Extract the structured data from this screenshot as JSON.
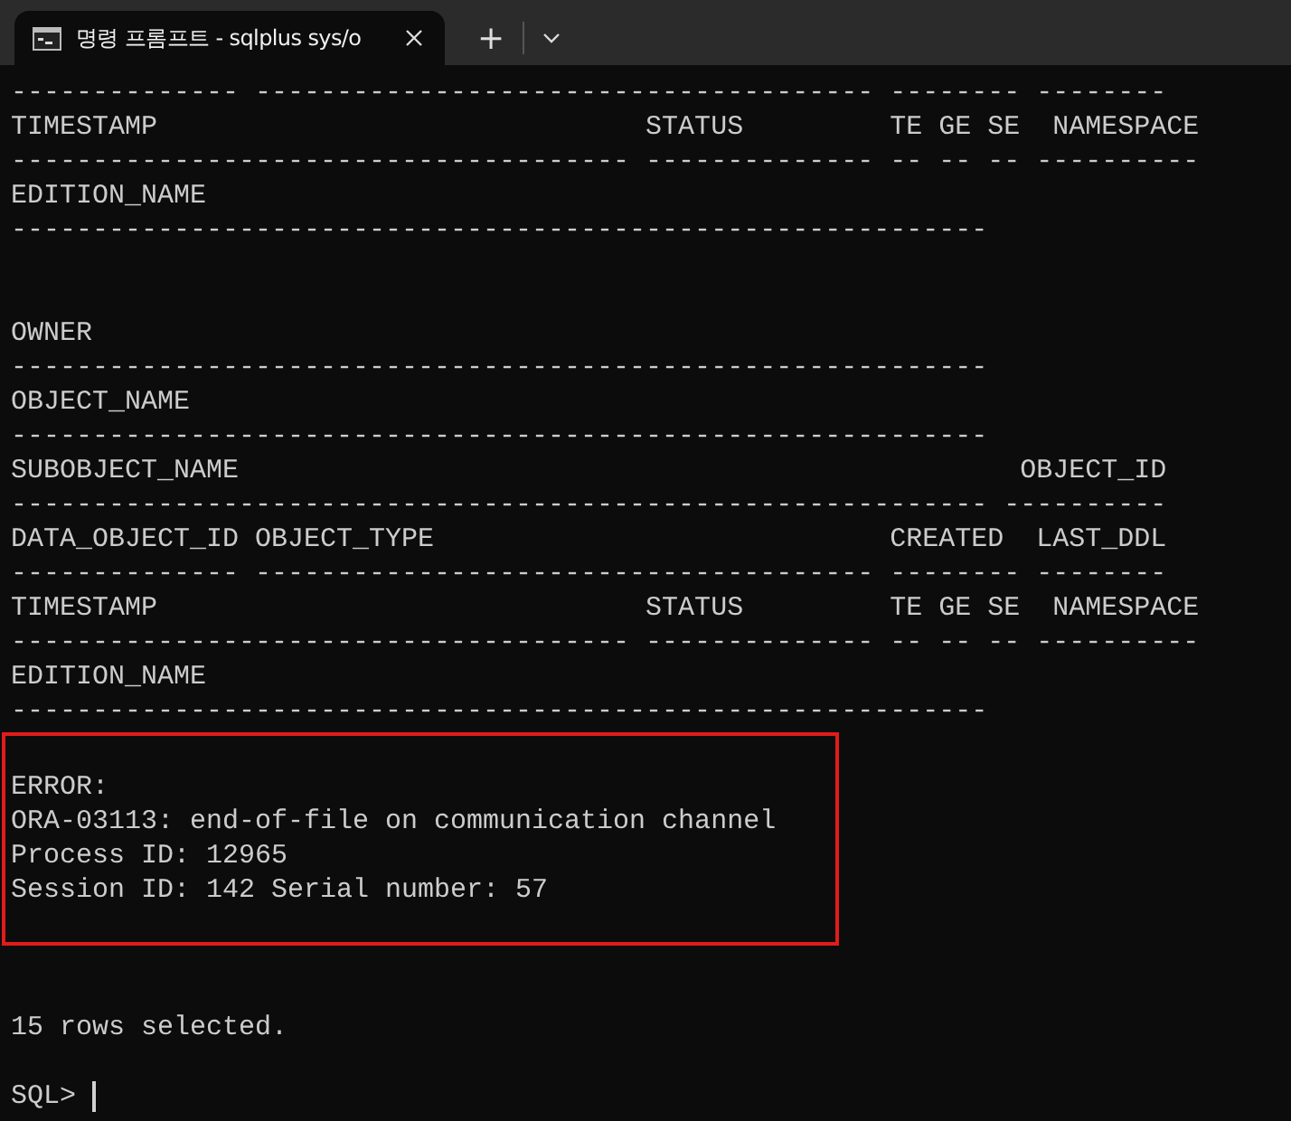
{
  "tab": {
    "title": "명령 프롬프트 - sqlplus  sys/o",
    "selected": true
  },
  "new_tab": "+",
  "output": [
    {
      "kind": "line",
      "text": "-------------- -------------------------------------- -------- --------"
    },
    {
      "kind": "line",
      "text": "TIMESTAMP                              STATUS         TE GE SE  NAMESPACE"
    },
    {
      "kind": "line",
      "text": "-------------------------------------- -------------- -- -- -- ----------"
    },
    {
      "kind": "line",
      "text": "EDITION_NAME"
    },
    {
      "kind": "line",
      "text": "------------------------------------------------------------"
    },
    {
      "kind": "blank"
    },
    {
      "kind": "blank"
    },
    {
      "kind": "line",
      "text": "OWNER"
    },
    {
      "kind": "line",
      "text": "------------------------------------------------------------"
    },
    {
      "kind": "line",
      "text": "OBJECT_NAME"
    },
    {
      "kind": "line",
      "text": "------------------------------------------------------------"
    },
    {
      "kind": "line",
      "text": "SUBOBJECT_NAME                                                OBJECT_ID"
    },
    {
      "kind": "line",
      "text": "------------------------------------------------------------ ----------"
    },
    {
      "kind": "line",
      "text": "DATA_OBJECT_ID OBJECT_TYPE                            CREATED  LAST_DDL"
    },
    {
      "kind": "line",
      "text": "-------------- -------------------------------------- -------- --------"
    },
    {
      "kind": "line",
      "text": "TIMESTAMP                              STATUS         TE GE SE  NAMESPACE"
    },
    {
      "kind": "line",
      "text": "-------------------------------------- -------------- -- -- -- ----------"
    },
    {
      "kind": "line",
      "text": "EDITION_NAME"
    },
    {
      "kind": "line",
      "text": "------------------------------------------------------------"
    },
    {
      "kind": "highlight",
      "lines": [
        {
          "kind": "blank"
        },
        {
          "kind": "line",
          "text": "ERROR:"
        },
        {
          "kind": "line",
          "text": "ORA-03113: end-of-file on communication channel"
        },
        {
          "kind": "line",
          "text": "Process ID: 12965"
        },
        {
          "kind": "line",
          "text": "Session ID: 142 Serial number: 57"
        },
        {
          "kind": "blank"
        }
      ]
    },
    {
      "kind": "blank"
    },
    {
      "kind": "blank"
    },
    {
      "kind": "line",
      "text": "15 rows selected."
    },
    {
      "kind": "blank"
    },
    {
      "kind": "prompt",
      "text": "SQL>"
    }
  ]
}
